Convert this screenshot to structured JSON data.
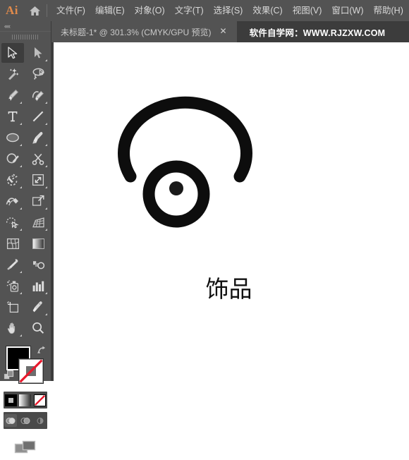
{
  "app": {
    "logo_text": "Ai",
    "home_icon": "home-icon"
  },
  "menubar": {
    "items": [
      {
        "label": "文件(F)",
        "name": "menu-file"
      },
      {
        "label": "编辑(E)",
        "name": "menu-edit"
      },
      {
        "label": "对象(O)",
        "name": "menu-object"
      },
      {
        "label": "文字(T)",
        "name": "menu-type"
      },
      {
        "label": "选择(S)",
        "name": "menu-select"
      },
      {
        "label": "效果(C)",
        "name": "menu-effect"
      },
      {
        "label": "视图(V)",
        "name": "menu-view"
      },
      {
        "label": "窗口(W)",
        "name": "menu-window"
      },
      {
        "label": "帮助(H)",
        "name": "menu-help"
      }
    ]
  },
  "tabbar": {
    "document_tab": {
      "title": "未标题-1* @ 301.3% (CMYK/GPU 预览)",
      "close_label": "✕",
      "doc_name": "未标题-1",
      "modified": "*",
      "zoom": "301.3%",
      "color_mode": "CMYK",
      "preview_mode": "GPU 预览"
    },
    "watermark": "软件自学网：WWW.RJZXW.COM"
  },
  "toolpanel": {
    "collapse_label": "««",
    "tools": [
      {
        "name": "selection-tool",
        "label": "选择工具",
        "active": true,
        "corner": false
      },
      {
        "name": "direct-selection-tool",
        "label": "直接选择工具",
        "active": false,
        "corner": true
      },
      {
        "name": "magic-wand-tool",
        "label": "魔棒工具",
        "active": false,
        "corner": false
      },
      {
        "name": "lasso-tool",
        "label": "套索工具",
        "active": false,
        "corner": false
      },
      {
        "name": "pen-tool",
        "label": "钢笔工具",
        "active": false,
        "corner": true
      },
      {
        "name": "curvature-tool",
        "label": "曲率工具",
        "active": false,
        "corner": true
      },
      {
        "name": "type-tool",
        "label": "文字工具",
        "active": false,
        "corner": true
      },
      {
        "name": "line-segment-tool",
        "label": "直线段工具",
        "active": false,
        "corner": true
      },
      {
        "name": "ellipse-tool",
        "label": "椭圆工具",
        "active": false,
        "corner": true
      },
      {
        "name": "paintbrush-tool",
        "label": "画笔工具",
        "active": false,
        "corner": true
      },
      {
        "name": "shaper-tool",
        "label": "Shaper 工具",
        "active": false,
        "corner": true
      },
      {
        "name": "scissors-tool",
        "label": "剪刀工具",
        "active": false,
        "corner": true
      },
      {
        "name": "rotate-tool",
        "label": "旋转工具",
        "active": false,
        "corner": true
      },
      {
        "name": "scale-tool",
        "label": "比例缩放工具",
        "active": false,
        "corner": true
      },
      {
        "name": "width-tool",
        "label": "宽度工具",
        "active": false,
        "corner": true
      },
      {
        "name": "free-transform-tool",
        "label": "自由变换工具",
        "active": false,
        "corner": true
      },
      {
        "name": "shape-builder-tool",
        "label": "形状生成器工具",
        "active": false,
        "corner": true
      },
      {
        "name": "perspective-grid-tool",
        "label": "透视网格工具",
        "active": false,
        "corner": true
      },
      {
        "name": "mesh-tool",
        "label": "网格工具",
        "active": false,
        "corner": false
      },
      {
        "name": "gradient-tool",
        "label": "渐变工具",
        "active": false,
        "corner": false
      },
      {
        "name": "eyedropper-tool",
        "label": "吸管工具",
        "active": false,
        "corner": true
      },
      {
        "name": "blend-tool",
        "label": "混合工具",
        "active": false,
        "corner": false
      },
      {
        "name": "symbol-sprayer-tool",
        "label": "符号喷枪工具",
        "active": false,
        "corner": true
      },
      {
        "name": "column-graph-tool",
        "label": "柱形图工具",
        "active": false,
        "corner": true
      },
      {
        "name": "artboard-tool",
        "label": "画板工具",
        "active": false,
        "corner": false
      },
      {
        "name": "slice-tool",
        "label": "切片工具",
        "active": false,
        "corner": true
      },
      {
        "name": "hand-tool",
        "label": "抓手工具",
        "active": false,
        "corner": true
      },
      {
        "name": "zoom-tool",
        "label": "缩放工具",
        "active": false,
        "corner": false
      }
    ],
    "fill_stroke": {
      "fill_color": "#000000",
      "stroke_color": "#ffffff",
      "stroke_is_none": true,
      "swap_icon": "swap-fill-stroke-icon",
      "default_icon": "default-fill-stroke-icon"
    },
    "color_modes": [
      {
        "name": "color-mode-button",
        "label": "颜色",
        "icon": "solid-color-icon"
      },
      {
        "name": "gradient-mode-button",
        "label": "渐变",
        "icon": "gradient-icon"
      },
      {
        "name": "none-mode-button",
        "label": "无",
        "icon": "none-icon"
      }
    ],
    "draw_modes": [
      {
        "name": "draw-normal-button",
        "label": "正常绘图",
        "selected": true
      },
      {
        "name": "draw-behind-button",
        "label": "背面绘图",
        "selected": false
      },
      {
        "name": "draw-inside-button",
        "label": "内部绘图",
        "selected": false
      }
    ],
    "screen_mode": {
      "name": "change-screen-mode-button",
      "label": "更改屏幕模式"
    }
  },
  "canvas": {
    "artwork": {
      "name": "jewelry-necklace-artwork",
      "label": "饰品图标",
      "caption": "饰品",
      "stroke_color": "#0d0d0d",
      "fill_color": "#ffffff",
      "pendant_dot_color": "#1a1a1a"
    }
  }
}
